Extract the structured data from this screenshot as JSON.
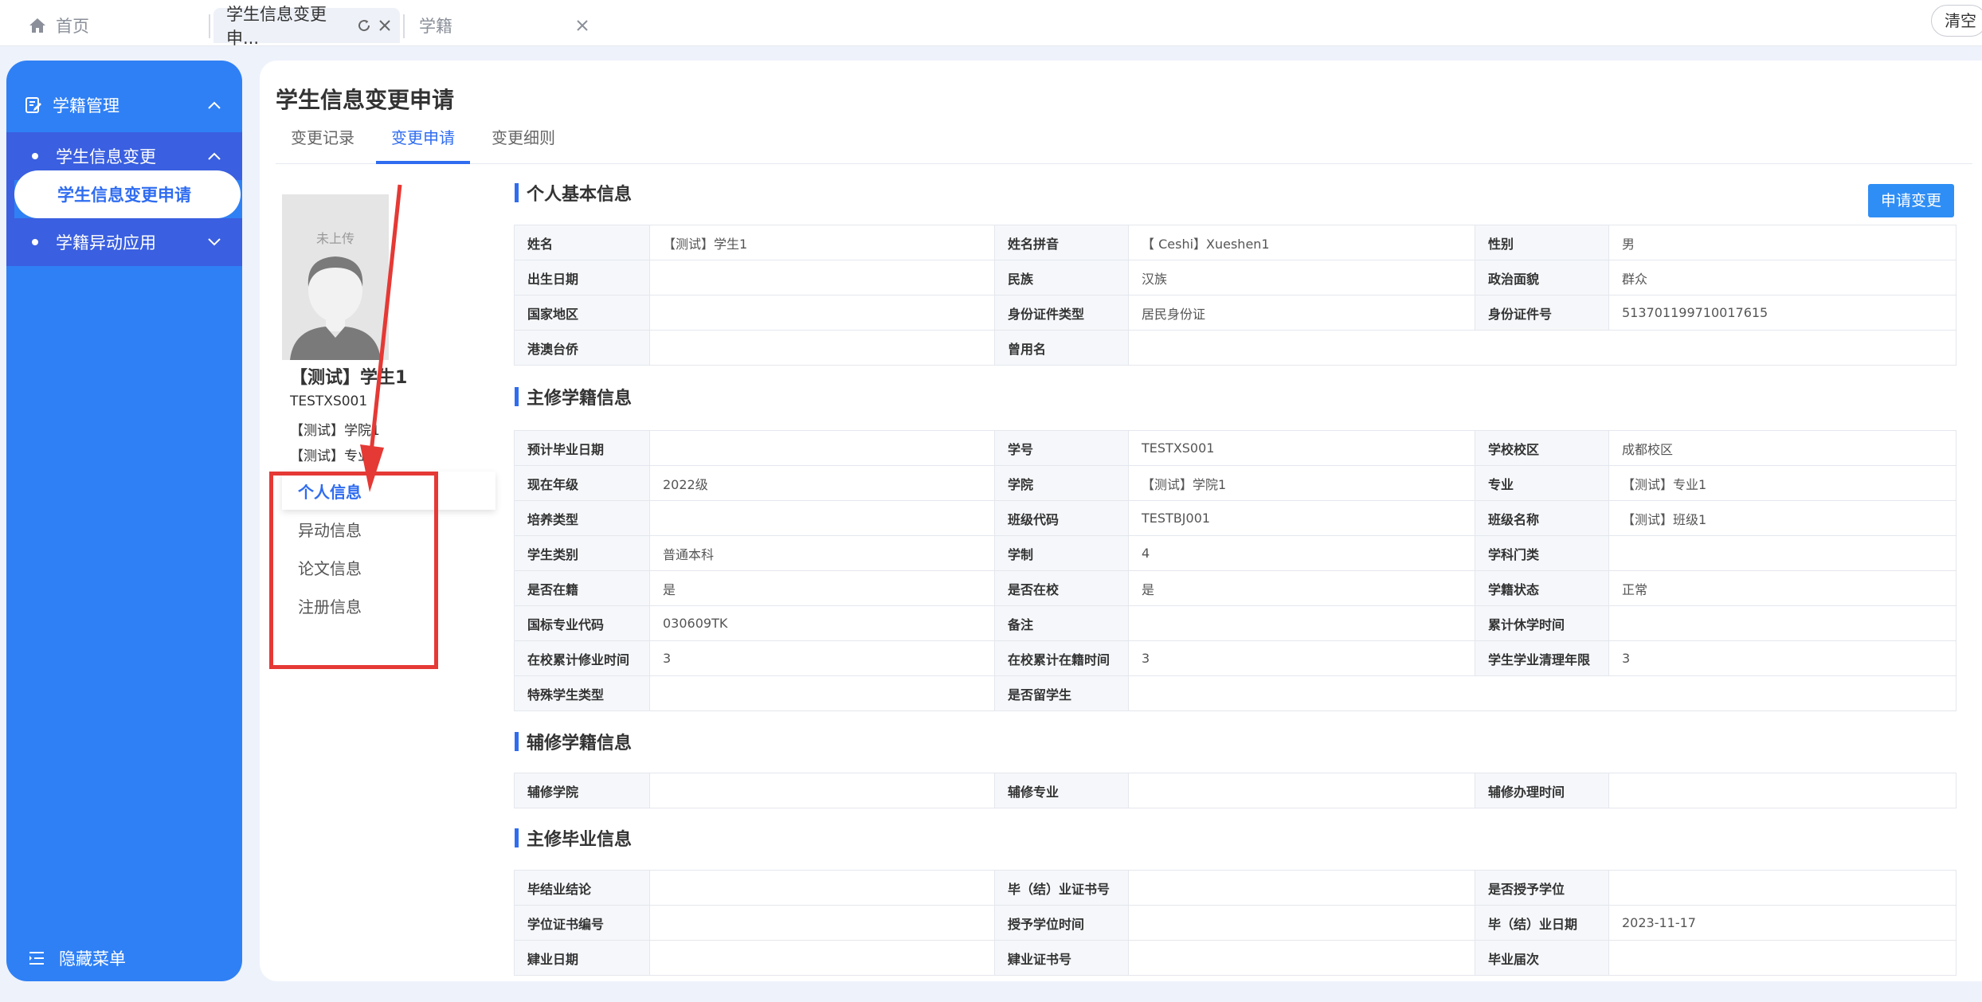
{
  "topbar": {
    "home_label": "首页",
    "active_tab_label": "学生信息变更申...",
    "third_tab_label": "学籍",
    "clear_label": "清空"
  },
  "sidebar": {
    "group_label": "学籍管理",
    "items": [
      {
        "label": "学生信息变更"
      },
      {
        "label": "学生信息变更申请"
      },
      {
        "label": "学籍异动应用"
      }
    ],
    "hide_menu_label": "隐藏菜单"
  },
  "page": {
    "title": "学生信息变更申请",
    "tabs": [
      "变更记录",
      "变更申请",
      "变更细则"
    ],
    "active_tab": "变更申请",
    "apply_button": "申请变更"
  },
  "profile": {
    "photo_placeholder": "未上传",
    "name": "【测试】学生1",
    "student_no": "TESTXS001",
    "college": "【测试】学院1",
    "major": "【测试】专业1",
    "nav": [
      "个人信息",
      "异动信息",
      "论文信息",
      "注册信息"
    ],
    "active_nav": "个人信息"
  },
  "sections": {
    "basic": {
      "title": "个人基本信息",
      "rows": [
        [
          "姓名",
          "【测试】学生1",
          "姓名拼音",
          "【 Ceshi】Xueshen1",
          "性别",
          "男"
        ],
        [
          "出生日期",
          "",
          "民族",
          "汉族",
          "政治面貌",
          "群众"
        ],
        [
          "国家地区",
          "",
          "身份证件类型",
          "居民身份证",
          "身份证件号",
          "513701199710017615"
        ],
        [
          "港澳台侨",
          "",
          "曾用名",
          ""
        ]
      ]
    },
    "major": {
      "title": "主修学籍信息",
      "rows": [
        [
          "预计毕业日期",
          "",
          "学号",
          "TESTXS001",
          "学校校区",
          "成都校区"
        ],
        [
          "现在年级",
          "2022级",
          "学院",
          "【测试】学院1",
          "专业",
          "【测试】专业1"
        ],
        [
          "培养类型",
          "",
          "班级代码",
          "TESTBJ001",
          "班级名称",
          "【测试】班级1"
        ],
        [
          "学生类别",
          "普通本科",
          "学制",
          "4",
          "学科门类",
          ""
        ],
        [
          "是否在籍",
          "是",
          "是否在校",
          "是",
          "学籍状态",
          "正常"
        ],
        [
          "国标专业代码",
          "030609TK",
          "备注",
          "",
          "累计休学时间",
          ""
        ],
        [
          "在校累计修业时间",
          "3",
          "在校累计在籍时间",
          "3",
          "学生学业清理年限",
          "3"
        ],
        [
          "特殊学生类型",
          "",
          "是否留学生",
          ""
        ]
      ]
    },
    "minor": {
      "title": "辅修学籍信息",
      "rows": [
        [
          "辅修学院",
          "",
          "辅修专业",
          "",
          "辅修办理时间",
          ""
        ]
      ]
    },
    "graduation": {
      "title": "主修毕业信息",
      "rows": [
        [
          "毕结业结论",
          "",
          "毕（结）业证书号",
          "",
          "是否授予学位",
          ""
        ],
        [
          "学位证书编号",
          "",
          "授予学位时间",
          "",
          "毕（结）业日期",
          "2023-11-17"
        ],
        [
          "肄业日期",
          "",
          "肄业证书号",
          "",
          "毕业届次",
          ""
        ]
      ]
    }
  },
  "colors": {
    "sidebar": "#2f80f5",
    "accent": "#2f6cf0",
    "annotation_red": "#e53935"
  }
}
